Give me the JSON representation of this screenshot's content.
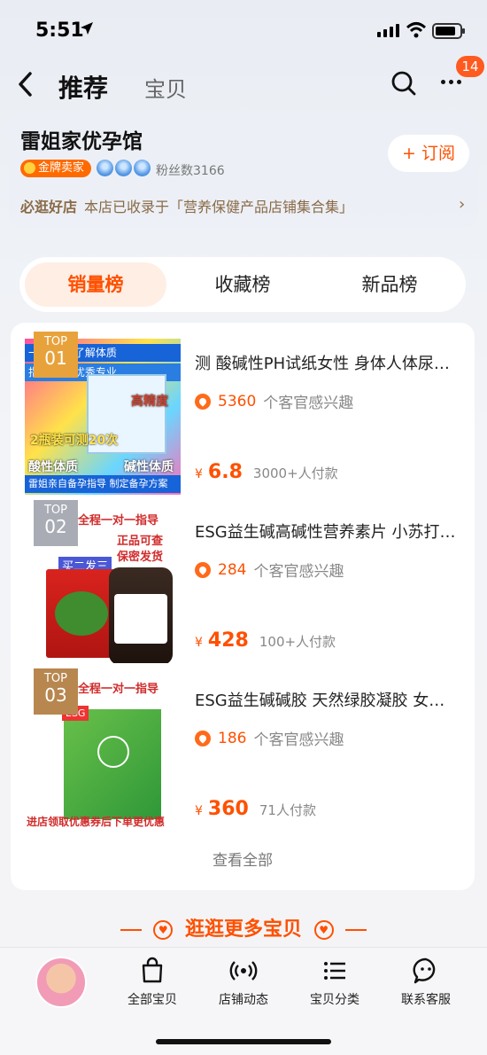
{
  "status_bar": {
    "time": "5:51"
  },
  "nav": {
    "tabs": [
      "推荐",
      "宝贝"
    ],
    "badge": "14"
  },
  "shop": {
    "name": "雷姐家优孕馆",
    "seller_badge": "金牌卖家",
    "fans": "粉丝数3166",
    "subscribe_label": "订阅",
    "subscribe_icon": "+",
    "strip_tag": "必逛好店",
    "strip_text": "本店已收录于「营养保健产品店铺集合集」",
    "arrow": "›"
  },
  "rank_tabs": {
    "items": [
      "销量榜",
      "收藏榜",
      "新品榜"
    ],
    "active": "销量榜"
  },
  "products": [
    {
      "rank_label": "TOP",
      "rank_no": "01",
      "title": "测 酸碱性PH试纸女性 身体人体尿液检测备孕",
      "interest_num": "5360",
      "interest_text": "个客官感兴趣",
      "price_symbol": "¥",
      "price": "6.8",
      "sold": "3000+人付款",
      "thumb_texts": [
        "一测 轻松了解体质",
        "指导老师 优秀专业",
        "高精度",
        "2瓶装可测20次",
        "酸性体质",
        "碱性体质",
        "雷姐亲自备孕指导 制定备孕方案"
      ]
    },
    {
      "rank_label": "TOP",
      "rank_no": "02",
      "title": "ESG益生碱高碱性营养素片 小苏打备孕调理",
      "interest_num": "284",
      "interest_text": "个客官感兴趣",
      "price_symbol": "¥",
      "price": "428",
      "sold": "100+人付款",
      "thumb_texts": [
        "全程一对一指导",
        "买二发三",
        "正品可查",
        "保密发货"
      ]
    },
    {
      "rank_label": "TOP",
      "rank_no": "03",
      "title": "ESG益生碱碱胶 天然绿胶凝胶 女性备孕",
      "interest_num": "186",
      "interest_text": "个客官感兴趣",
      "price_symbol": "¥",
      "price": "360",
      "sold": "71人付款",
      "thumb_texts": [
        "全程一对一指导",
        "进店领取优惠券后下单更优惠"
      ]
    }
  ],
  "view_all": "查看全部",
  "more_header": "逛逛更多宝贝",
  "bottom_bar": [
    {
      "label": "全部宝贝",
      "icon": "bag-icon"
    },
    {
      "label": "店铺动态",
      "icon": "broadcast-icon"
    },
    {
      "label": "宝贝分类",
      "icon": "list-icon"
    },
    {
      "label": "联系客服",
      "icon": "chat-icon"
    }
  ],
  "colors": {
    "accent": "#ff5000",
    "rank1": "#e8a23c",
    "rank2": "#a9acb5",
    "rank3": "#b7874f"
  }
}
